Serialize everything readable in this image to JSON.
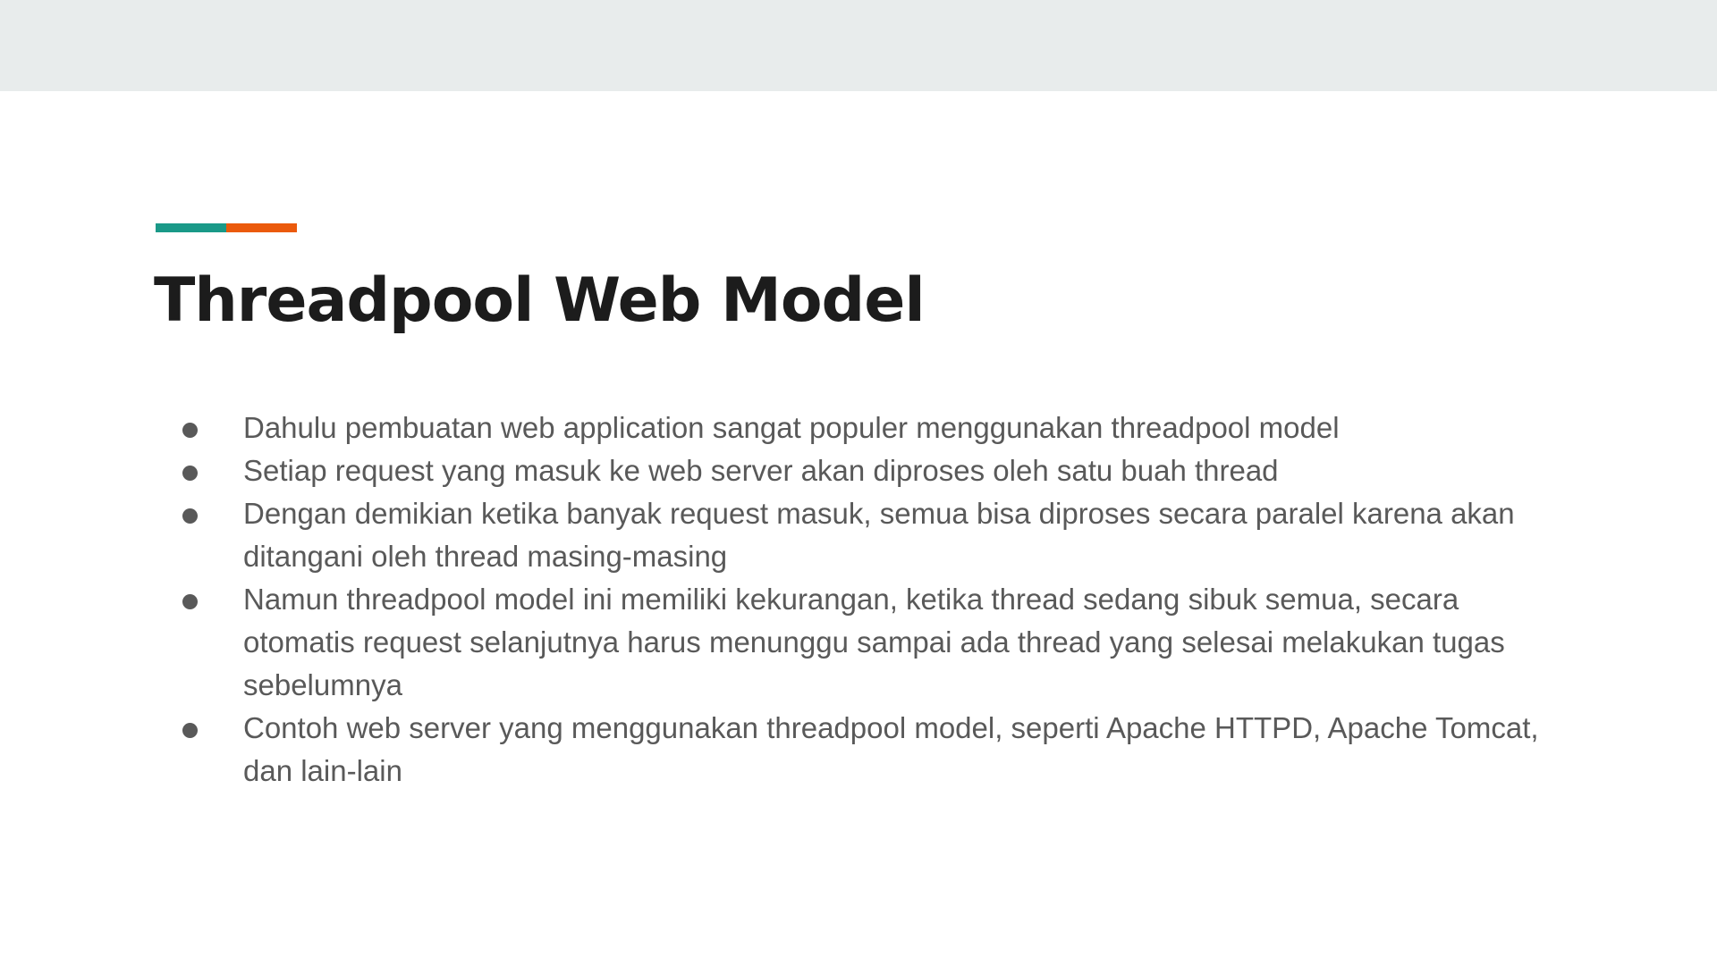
{
  "colors": {
    "top_band": "#e8ecec",
    "accent_teal": "#1a9988",
    "accent_orange": "#eb5a0c",
    "title": "#1c1c1c",
    "body_text": "#595959"
  },
  "slide": {
    "title": "Threadpool Web Model",
    "bullets": [
      {
        "text": "Dahulu pembuatan web application sangat populer menggunakan threadpool model"
      },
      {
        "text": "Setiap request yang masuk ke web server akan diproses oleh satu buah thread"
      },
      {
        "text": "Dengan demikian ketika banyak request masuk, semua bisa diproses secara paralel karena akan ditangani oleh thread masing-masing"
      },
      {
        "text": "Namun threadpool model ini memiliki kekurangan, ketika thread sedang sibuk semua, secara otomatis request selanjutnya harus menunggu sampai ada thread yang selesai melakukan tugas sebelumnya"
      },
      {
        "text": "Contoh web server yang menggunakan threadpool model, seperti Apache HTTPD, Apache Tomcat, dan lain-lain"
      }
    ]
  }
}
